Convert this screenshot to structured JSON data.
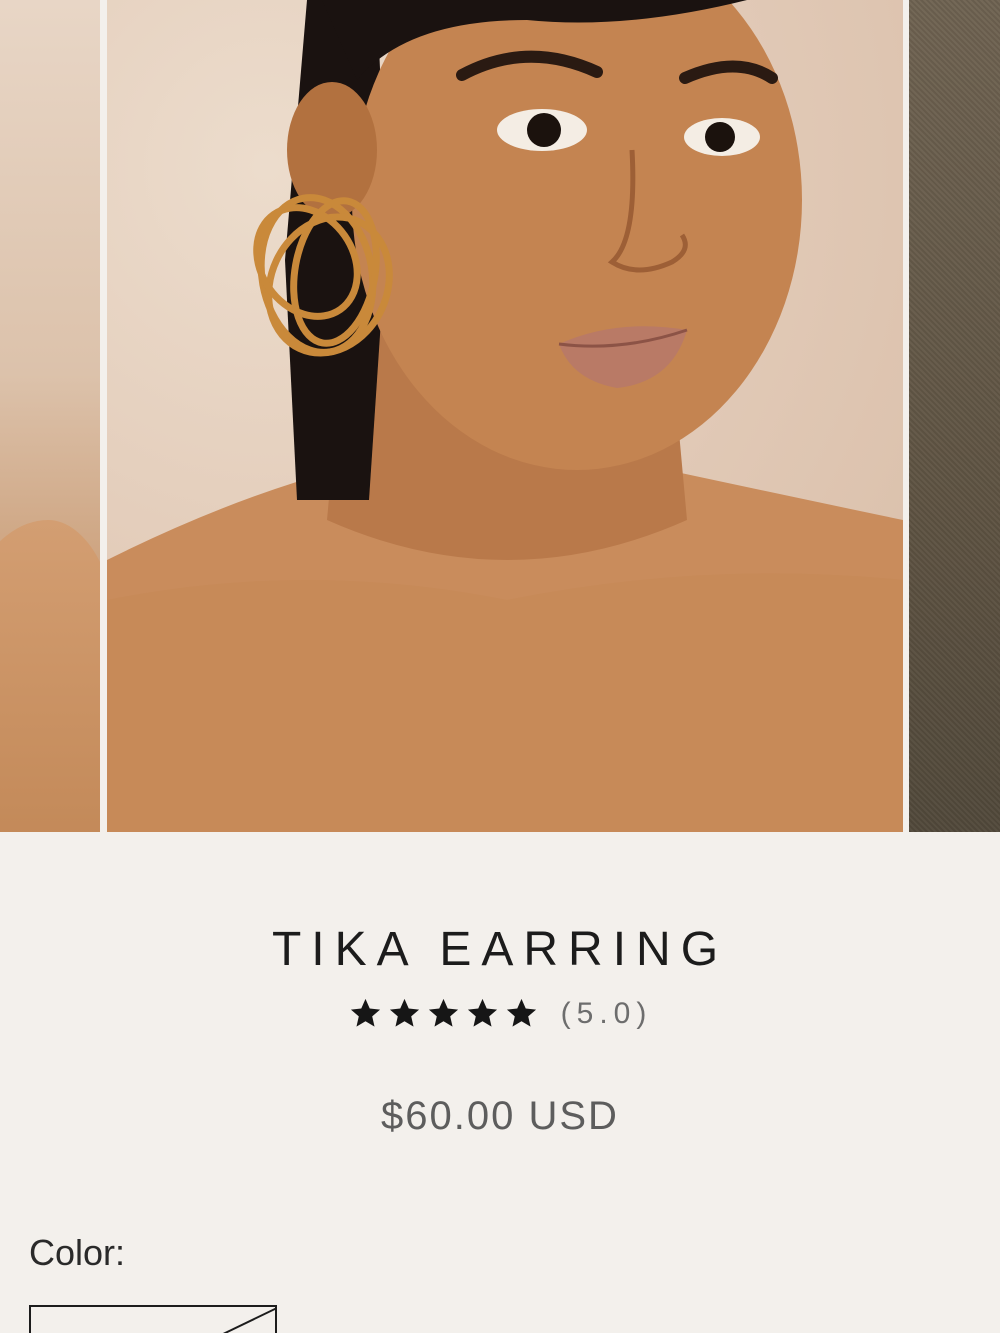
{
  "gallery": {
    "previous_image": "product-photo-previous",
    "main_image": "model-wearing-gold-hoop-earring",
    "next_image": "product-photo-next"
  },
  "product": {
    "title": "TIKA EARRING",
    "rating": {
      "stars": 5,
      "max_stars": 5,
      "value_text": "(5.0)"
    },
    "price": "$60.00 USD"
  },
  "options": {
    "color_label": "Color:",
    "selected_swatch": "color-swatch-selected"
  },
  "colors": {
    "background": "#f3f0ec",
    "text_primary": "#1c1c1c",
    "text_muted": "#6d6d6d",
    "earring_gold": "#c9893a"
  }
}
